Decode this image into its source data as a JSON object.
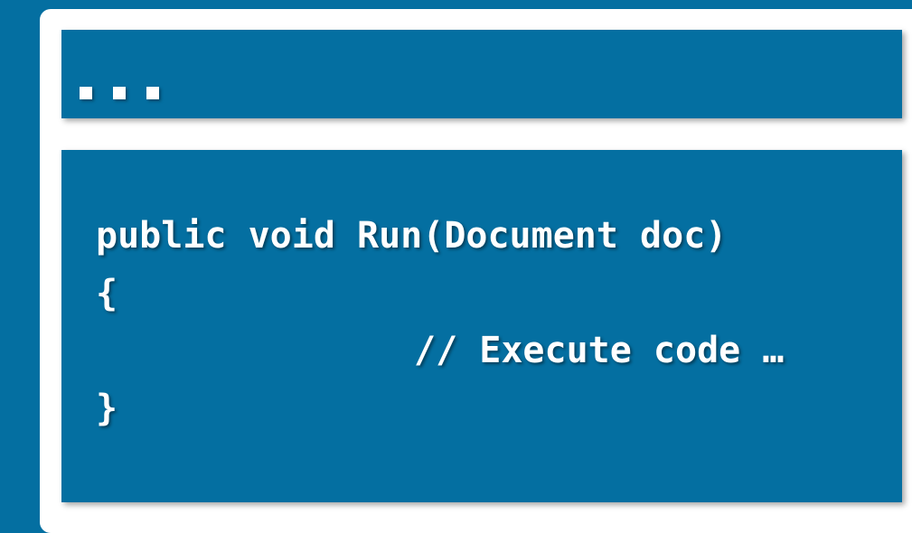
{
  "code": {
    "lines": [
      "public void Run(Document doc)",
      "{",
      "// Execute code …",
      "}"
    ]
  },
  "colors": {
    "background": "#046fa1",
    "frame": "#ffffff",
    "text": "#ffffff"
  }
}
